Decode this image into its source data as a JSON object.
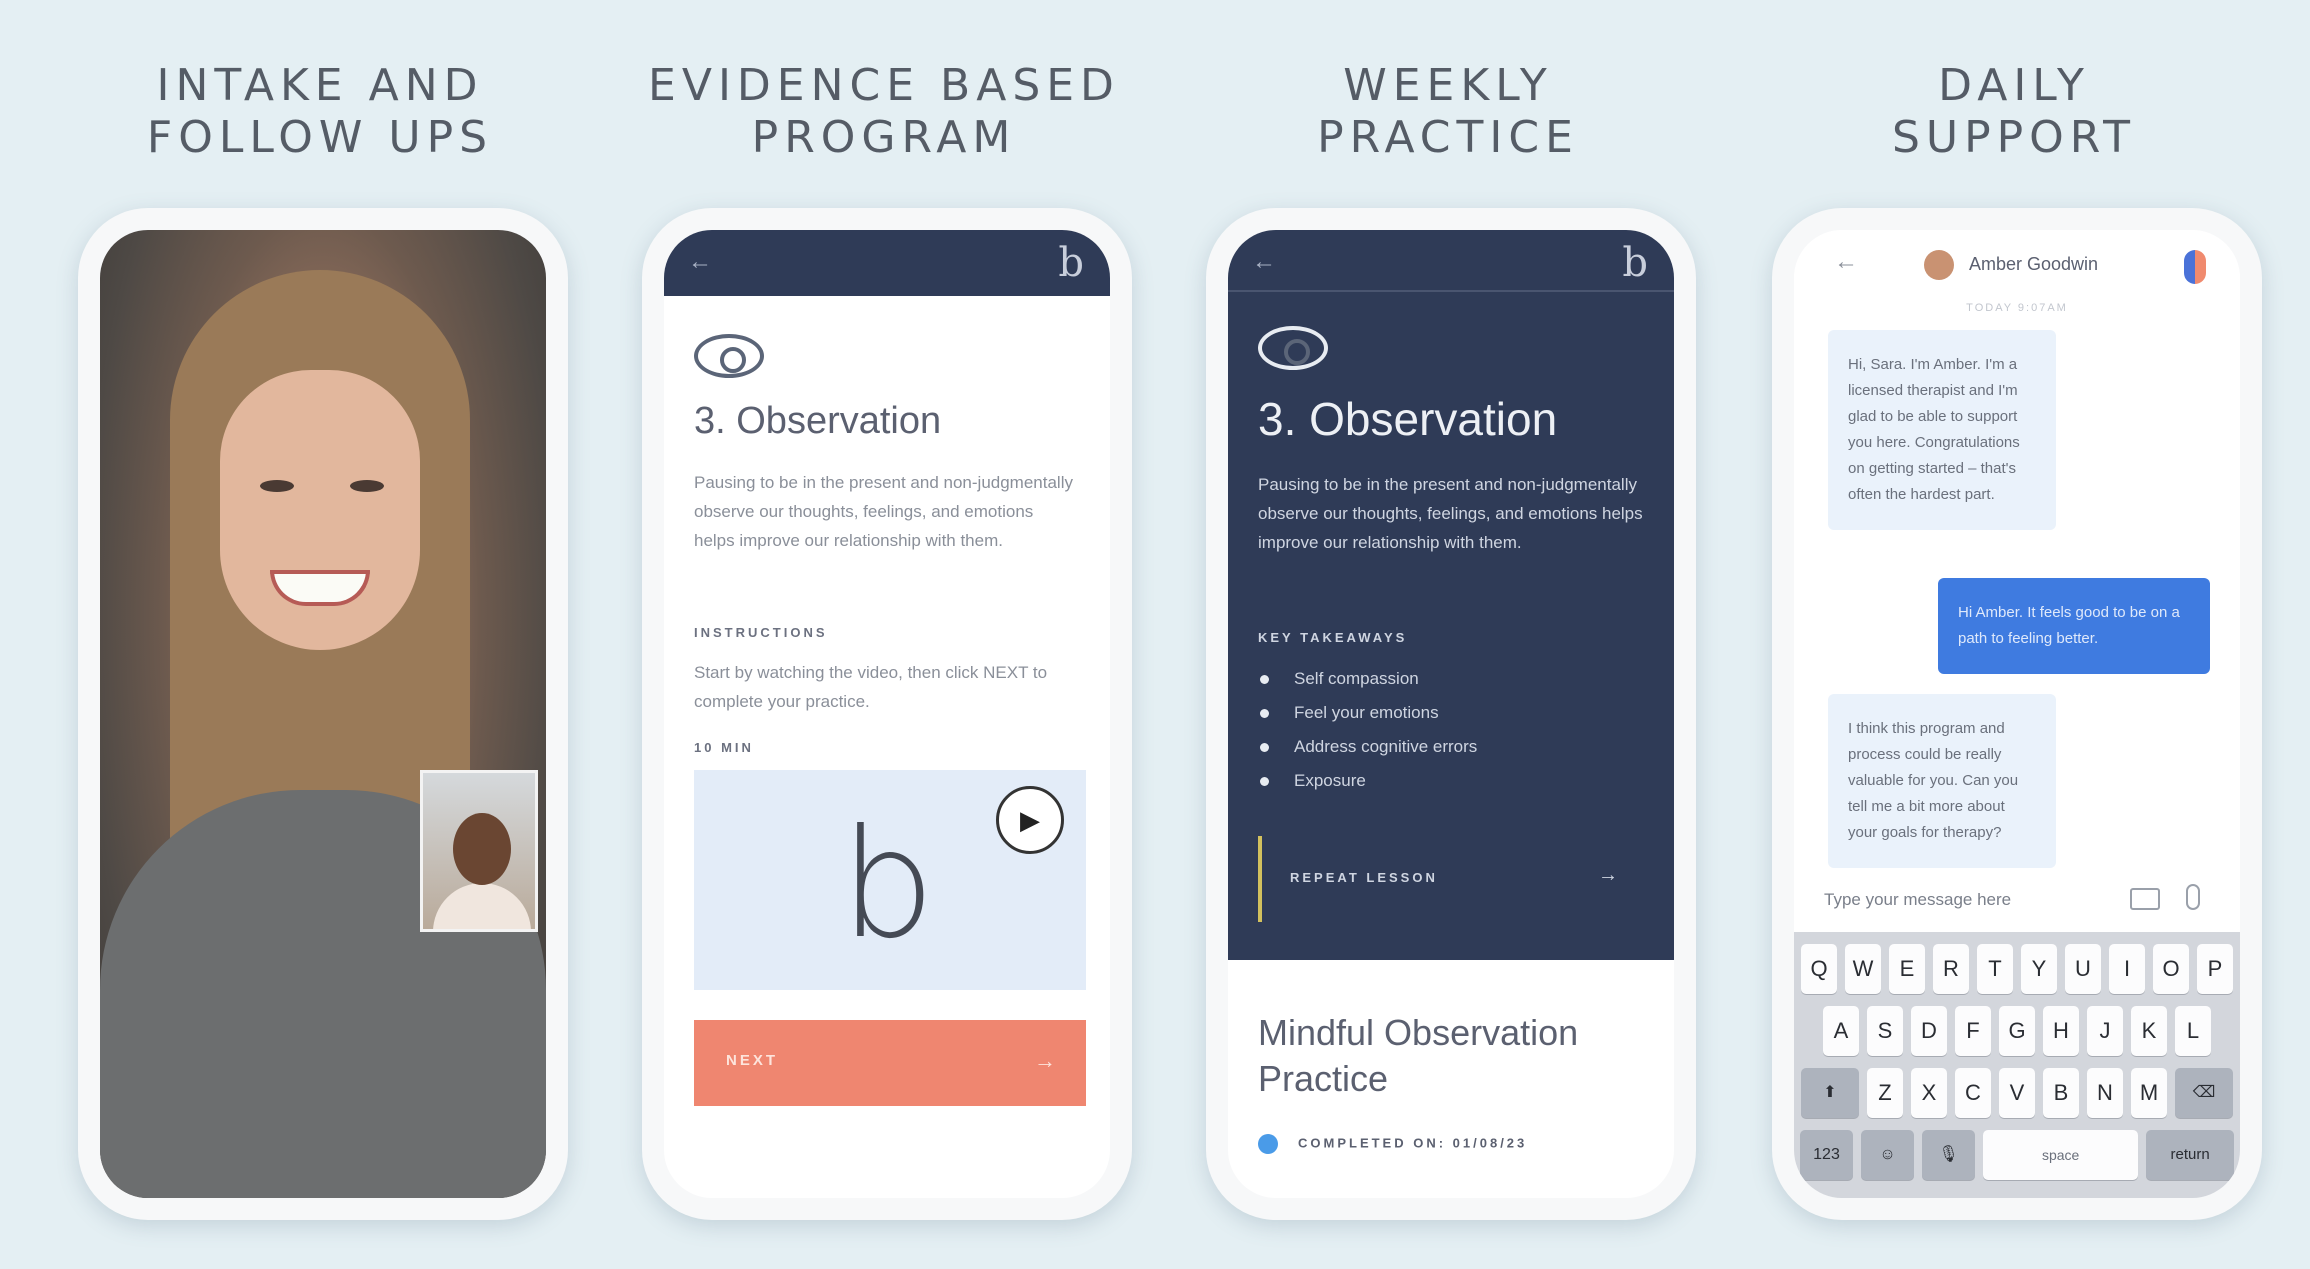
{
  "panels": [
    {
      "heading": "INTAKE AND\nFOLLOW UPS"
    },
    {
      "heading": "EVIDENCE BASED\nPROGRAM"
    },
    {
      "heading": "WEEKLY\nPRACTICE"
    },
    {
      "heading": "DAILY\nSUPPORT"
    }
  ],
  "program": {
    "back_icon": "←",
    "logo_glyph": "b",
    "title": "3. Observation",
    "body": "Pausing to be in the present and non-judgmentally observe our thoughts, feelings, and emotions helps improve our relationship with them.",
    "instructions_label": "INSTRUCTIONS",
    "instructions": "Start by watching the video, then click NEXT to complete your practice.",
    "duration": "10 MIN",
    "video_logo": "b",
    "play_icon": "▶",
    "next_label": "NEXT",
    "next_arrow": "→",
    "accent": "#ef8670",
    "header_color": "#2f3b57"
  },
  "practice": {
    "back_icon": "←",
    "logo_glyph": "b",
    "title": "3. Observation",
    "body": "Pausing to be in the present and non-judgmentally observe our thoughts, feelings, and emotions helps improve our relationship with them.",
    "takeaways_label": "KEY TAKEAWAYS",
    "takeaways": [
      "Self compassion",
      "Feel your emotions",
      "Address cognitive errors",
      "Exposure"
    ],
    "repeat_label": "REPEAT LESSON",
    "repeat_arrow": "→",
    "lesson_title": "Mindful Observation Practice",
    "completed": "COMPLETED ON: 01/08/23"
  },
  "chat": {
    "back_icon": "←",
    "contact_name": "Amber Goodwin",
    "day_label": "TODAY 9:07AM",
    "messages": [
      {
        "from": "them",
        "text": "Hi, Sara. I'm Amber. I'm a licensed therapist and I'm glad to be able to support you here. Congratulations on getting started – that's often the hardest part."
      },
      {
        "from": "me",
        "text": "Hi Amber. It feels good to be on a path to feeling better."
      },
      {
        "from": "them",
        "text": "I think this program and process could be really valuable for you. Can you tell me a bit more about your goals for therapy?"
      }
    ],
    "input_placeholder": "Type your message here",
    "keyboard": {
      "row1": [
        "Q",
        "W",
        "E",
        "R",
        "T",
        "Y",
        "U",
        "I",
        "O",
        "P"
      ],
      "row2": [
        "A",
        "S",
        "D",
        "F",
        "G",
        "H",
        "J",
        "K",
        "L"
      ],
      "row3": [
        "Z",
        "X",
        "C",
        "V",
        "B",
        "N",
        "M"
      ],
      "shift": "⬆",
      "delete": "⌫",
      "num": "123",
      "emoji": "☺",
      "mic": "🎙",
      "space": "space",
      "return": "return"
    }
  }
}
